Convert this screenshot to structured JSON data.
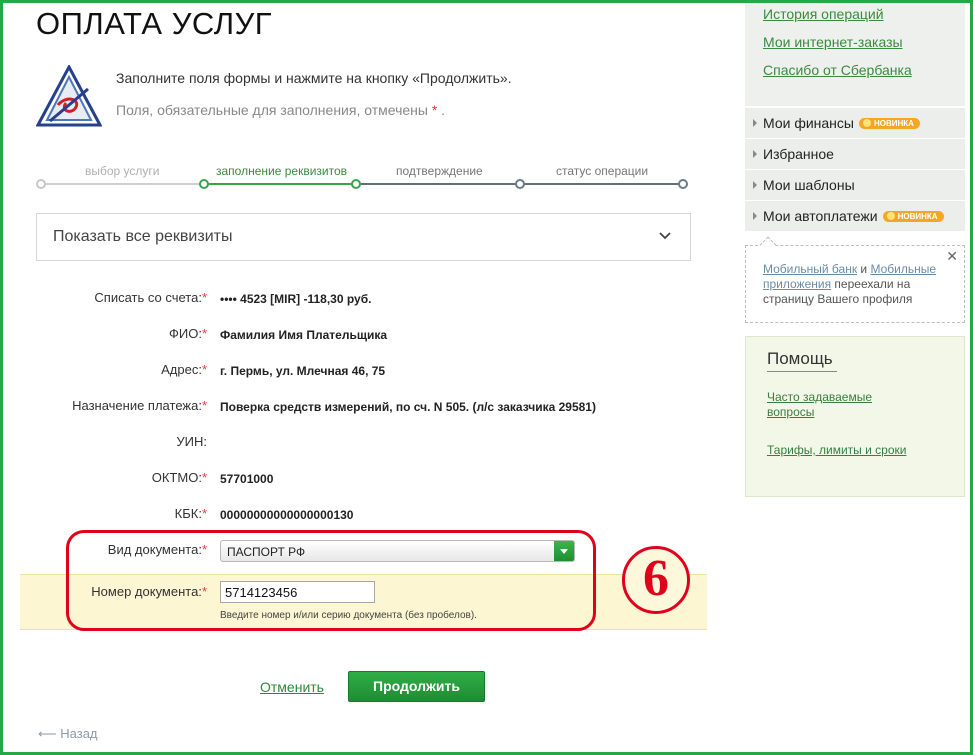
{
  "page": {
    "title": "ОПЛАТА УСЛУГ"
  },
  "intro": {
    "text": "Заполните поля формы и нажмите на кнопку «Продолжить».",
    "note_prefix": "Поля, обязательные для заполнения, отмечены",
    "note_star": "*",
    "note_suffix": "."
  },
  "stepper": {
    "steps": [
      {
        "label": "выбор услуги",
        "state": "done"
      },
      {
        "label": "заполнение реквизитов",
        "state": "active"
      },
      {
        "label": "подтверждение",
        "state": "pending"
      },
      {
        "label": "статус операции",
        "state": "pending"
      }
    ],
    "colors": {
      "done": "#cccccc",
      "active": "#3aa34b",
      "pending": "#5f6f7c"
    }
  },
  "details": {
    "label": "Показать все реквизиты"
  },
  "fields": [
    {
      "label": "Списать со счета:",
      "required": true,
      "value": "•••• 4523  [MIR] -118,30   руб."
    },
    {
      "label": "ФИО:",
      "required": true,
      "value": "Фамилия Имя Плательщика"
    },
    {
      "label": "Адрес:",
      "required": true,
      "value": "г. Пермь, ул. Млечная 46, 75"
    },
    {
      "label": "Назначение платежа:",
      "required": true,
      "value": "Поверка средств измерений, по сч. N 505. (л/с заказчика 29581)"
    },
    {
      "label": "УИН:",
      "required": false,
      "value": ""
    },
    {
      "label": "ОКТМО:",
      "required": true,
      "value": "57701000"
    },
    {
      "label": "КБК:",
      "required": true,
      "value": "00000000000000000130"
    }
  ],
  "document": {
    "type_label": "Вид документа:",
    "type_value": "ПАСПОРТ РФ",
    "number_label": "Номер документа:",
    "number_value": "5714123456",
    "hint": "Введите номер и/или серию документа (без пробелов)."
  },
  "star": "*",
  "annotation": {
    "number": "6"
  },
  "actions": {
    "cancel": "Отменить",
    "continue": "Продолжить",
    "back": "Назад"
  },
  "sidebar": {
    "top_links": [
      "История операций",
      "Мои интернет-заказы",
      "Спасибо от Сбербанка"
    ],
    "menu": [
      {
        "label": "Мои финансы",
        "badge": "НОВИНКА"
      },
      {
        "label": "Избранное",
        "badge": ""
      },
      {
        "label": "Мои шаблоны",
        "badge": ""
      },
      {
        "label": "Мои автоплатежи",
        "badge": "НОВИНКА"
      }
    ],
    "notice": {
      "link1": "Мобильный банк",
      "and": " и ",
      "link2": "Мобильные приложения",
      "rest": " переехали на страницу Вашего профиля"
    },
    "help": {
      "title": "Помощь",
      "links": [
        "Часто задаваемые вопросы",
        "Тарифы, лимиты и сроки"
      ]
    }
  },
  "colors": {
    "brand_green": "#27a844",
    "annotation_red": "#e0001b",
    "highlight": "#fcf6d2"
  }
}
